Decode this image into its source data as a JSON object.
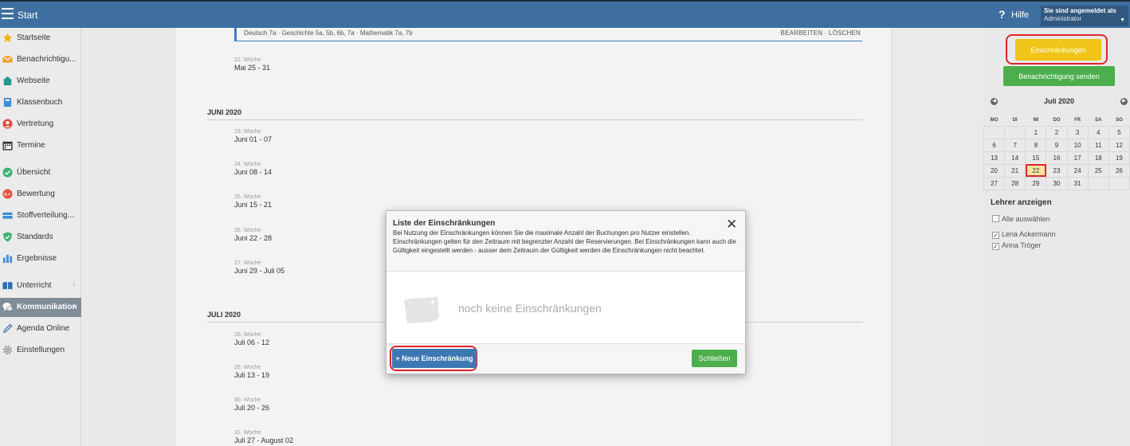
{
  "topbar": {
    "title": "Start",
    "help_label": "Hilfe",
    "user_label": "Sie sind angemeldet als",
    "user_name": "Administrator"
  },
  "sidebar": {
    "items": [
      {
        "label": "Startseite",
        "icon": "star-icon"
      },
      {
        "label": "Benachrichtigu...",
        "icon": "envelope-icon"
      },
      {
        "label": "Webseite",
        "icon": "home-icon"
      },
      {
        "label": "Klassenbuch",
        "icon": "book-icon"
      },
      {
        "label": "Vertretung",
        "icon": "person-icon"
      },
      {
        "label": "Termine",
        "icon": "calendar-icon"
      },
      {
        "label": "Übersicht",
        "icon": "check-circle-icon"
      },
      {
        "label": "Bewertung",
        "icon": "grade-icon"
      },
      {
        "label": "Stoffverteilung...",
        "icon": "layers-icon"
      },
      {
        "label": "Standards",
        "icon": "shield-icon"
      },
      {
        "label": "Ergebnisse",
        "icon": "bar-chart-icon"
      },
      {
        "label": "Unterricht",
        "icon": "open-book-icon"
      },
      {
        "label": "Kommunikation",
        "icon": "chat-icon"
      },
      {
        "label": "Agenda Online",
        "icon": "pencil-icon"
      },
      {
        "label": "Einstellungen",
        "icon": "gear-icon"
      }
    ]
  },
  "main": {
    "first_entry": {
      "subjects": "Deutsch 7a · Geschichte 5a, 5b, 6b, 7a · Mathematik 7a, 7b",
      "actions": "BEARBEITEN · LÖSCHEN"
    },
    "months": [
      "JUNI 2020",
      "JULI 2020"
    ],
    "weeks": [
      {
        "label": "22. Woche",
        "range": "Mai 25 - 31"
      },
      {
        "label": "23. Woche",
        "range": "Juni 01 - 07"
      },
      {
        "label": "24. Woche",
        "range": "Juni 08 - 14"
      },
      {
        "label": "25. Woche",
        "range": "Juni 15 - 21"
      },
      {
        "label": "26. Woche",
        "range": "Juni 22 - 28"
      },
      {
        "label": "27. Woche",
        "range": "Juni 29 - Juli 05"
      },
      {
        "label": "28. Woche",
        "range": "Juli 06 - 12"
      },
      {
        "label": "29. Woche",
        "range": "Juli 13 - 19"
      },
      {
        "label": "30. Woche",
        "range": "Juli 20 - 26"
      },
      {
        "label": "31. Woche",
        "range": "Juli 27 - August 02"
      }
    ]
  },
  "right": {
    "restrictions_button": "Einschränkungen",
    "notify_button": "Benachrichtigung senden",
    "calendar": {
      "month": "Juli 2020",
      "weekdays": [
        "MO",
        "DI",
        "MI",
        "DO",
        "FR",
        "SA",
        "SO"
      ],
      "rows": [
        [
          "",
          "",
          "1",
          "2",
          "3",
          "4",
          "5"
        ],
        [
          "6",
          "7",
          "8",
          "9",
          "10",
          "11",
          "12"
        ],
        [
          "13",
          "14",
          "15",
          "16",
          "17",
          "18",
          "19"
        ],
        [
          "20",
          "21",
          "22",
          "23",
          "24",
          "25",
          "26"
        ],
        [
          "27",
          "28",
          "29",
          "30",
          "31",
          "",
          ""
        ]
      ],
      "today": "22"
    },
    "teachers_title": "Lehrer anzeigen",
    "select_all": "Alle auswählen",
    "teachers": [
      "Lena Ackermann",
      "Anna Tröger"
    ]
  },
  "modal": {
    "title": "Liste der Einschränkungen",
    "description": "Bei Nutzung der Einschränkungen können Sie die maximale Anzahl der Buchungen pro Nutzer einstellen. Einschränkungen gelten für den Zeitraum mit begrenzter Anzahl der Reservierungen. Bei Einschränkungen kann auch die Gültigkeit eingestellt werden - ausser dem Zeitraum der Gültigkeit werden die Einschränkungen nicht beachtet.",
    "empty_text": "noch keine Einschränkungen",
    "new_button": "+ Neue Einschränkung",
    "close_button": "Schließen",
    "close_icon": "close-icon"
  },
  "colors": {
    "topbar": "#3f6fa0",
    "accent_yellow": "#f0c419",
    "accent_green": "#4cae4c",
    "accent_blue": "#3c78b4",
    "highlight_red": "#e0262b"
  }
}
